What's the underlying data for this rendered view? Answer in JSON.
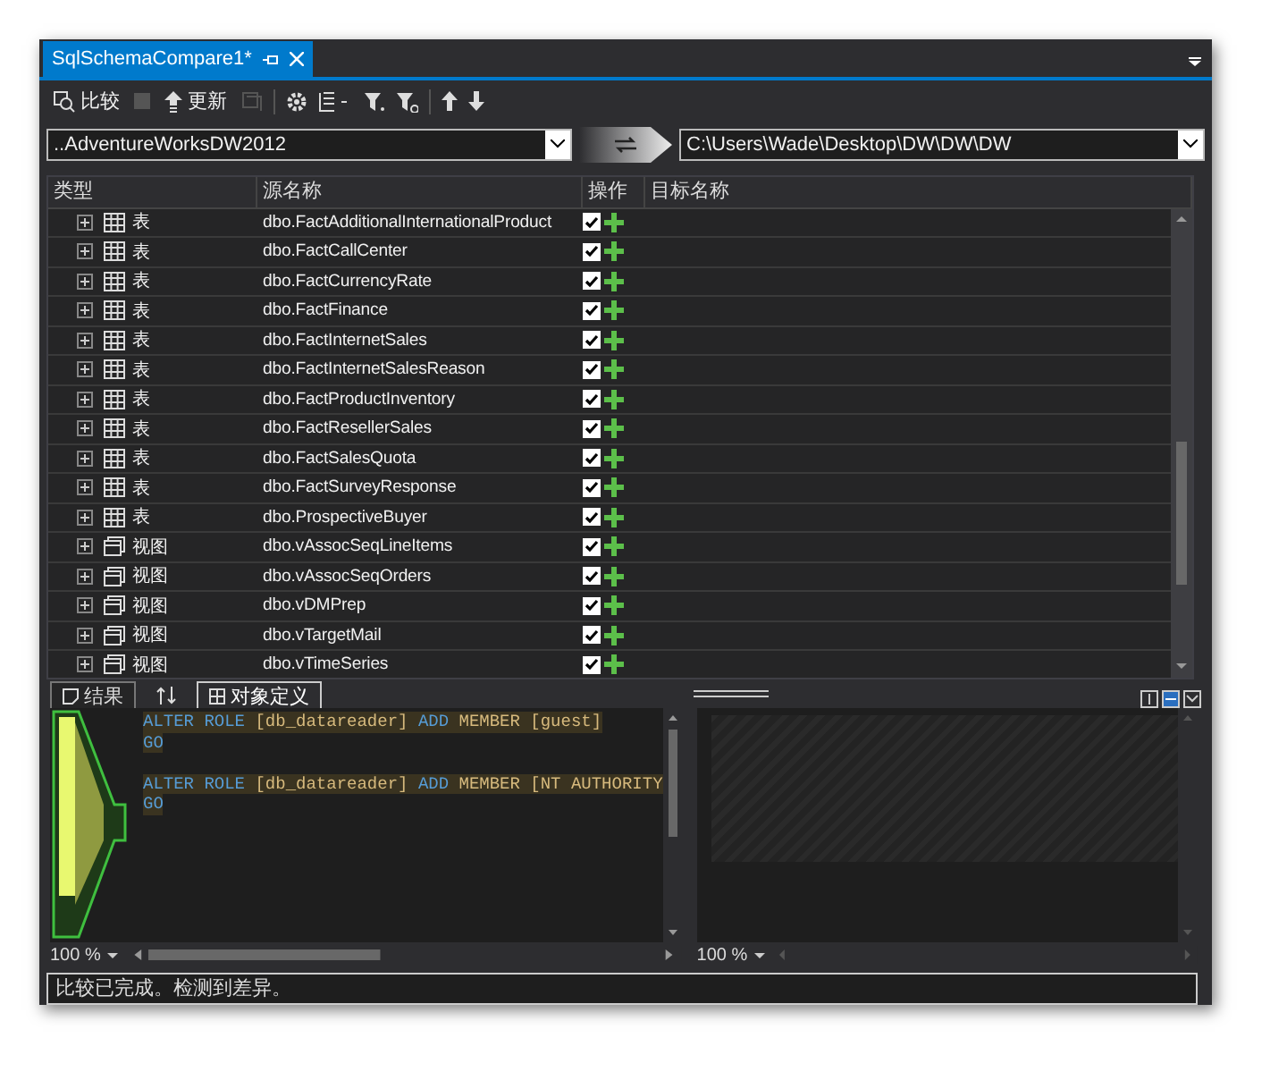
{
  "document_tab": {
    "title": "SqlSchemaCompare1*",
    "selected": true
  },
  "toolbar": {
    "buttons": [
      {
        "kind": "compare",
        "label": "比较"
      },
      {
        "kind": "update",
        "label": "更新"
      }
    ]
  },
  "source": {
    "value": "..AdventureWorksDW2012"
  },
  "target": {
    "value": "C:\\Users\\Wade\\Desktop\\DW\\DW\\DW"
  },
  "grid": {
    "columns": [
      "类型",
      "源名称",
      "操作",
      "目标名称"
    ],
    "rows": [
      {
        "kind": "table",
        "type": "表",
        "name": "dbo.FactAdditionalInternationalProduct",
        "included": true,
        "adding": true
      },
      {
        "kind": "table",
        "type": "表",
        "name": "dbo.FactCallCenter",
        "included": true,
        "adding": true
      },
      {
        "kind": "table",
        "type": "表",
        "name": "dbo.FactCurrencyRate",
        "included": true,
        "adding": true
      },
      {
        "kind": "table",
        "type": "表",
        "name": "dbo.FactFinance",
        "included": true,
        "adding": true
      },
      {
        "kind": "table",
        "type": "表",
        "name": "dbo.FactInternetSales",
        "included": true,
        "adding": true
      },
      {
        "kind": "table",
        "type": "表",
        "name": "dbo.FactInternetSalesReason",
        "included": true,
        "adding": true
      },
      {
        "kind": "table",
        "type": "表",
        "name": "dbo.FactProductInventory",
        "included": true,
        "adding": true
      },
      {
        "kind": "table",
        "type": "表",
        "name": "dbo.FactResellerSales",
        "included": true,
        "adding": true
      },
      {
        "kind": "table",
        "type": "表",
        "name": "dbo.FactSalesQuota",
        "included": true,
        "adding": true
      },
      {
        "kind": "table",
        "type": "表",
        "name": "dbo.FactSurveyResponse",
        "included": true,
        "adding": true
      },
      {
        "kind": "table",
        "type": "表",
        "name": "dbo.ProspectiveBuyer",
        "included": true,
        "adding": true
      },
      {
        "kind": "view",
        "type": "视图",
        "name": "dbo.vAssocSeqLineItems",
        "included": true,
        "adding": true
      },
      {
        "kind": "view",
        "type": "视图",
        "name": "dbo.vAssocSeqOrders",
        "included": true,
        "adding": true
      },
      {
        "kind": "view",
        "type": "视图",
        "name": "dbo.vDMPrep",
        "included": true,
        "adding": true
      },
      {
        "kind": "view",
        "type": "视图",
        "name": "dbo.vTargetMail",
        "included": true,
        "adding": true
      },
      {
        "kind": "view",
        "type": "视图",
        "name": "dbo.vTimeSeries",
        "included": true,
        "adding": true
      }
    ]
  },
  "bottom_tabs": [
    {
      "kind": "results",
      "label": "结果",
      "selected": false
    },
    {
      "kind": "sort"
    },
    {
      "kind": "definition",
      "label": "对象定义",
      "selected": true
    }
  ],
  "script": {
    "statements": [
      {
        "lines": [
          [
            {
              "kind": "keyword",
              "text": "ALTER ROLE"
            },
            {
              "kind": "text",
              "text": " [db_datareader] "
            },
            {
              "kind": "keyword",
              "text": "ADD"
            },
            {
              "kind": "text",
              "text": " MEMBER [guest]"
            }
          ],
          [
            {
              "kind": "keyword",
              "text": "GO"
            }
          ]
        ]
      },
      {
        "lines": [
          [
            {
              "kind": "keyword",
              "text": "ALTER ROLE"
            },
            {
              "kind": "text",
              "text": " [db_datareader] "
            },
            {
              "kind": "keyword",
              "text": "ADD"
            },
            {
              "kind": "text",
              "text": " MEMBER [NT AUTHORITY"
            }
          ],
          [
            {
              "kind": "keyword",
              "text": "GO"
            }
          ]
        ]
      }
    ]
  },
  "left_zoom": "100 %",
  "right_zoom": "100 %",
  "status_bar": "比较已完成。检测到差异。"
}
